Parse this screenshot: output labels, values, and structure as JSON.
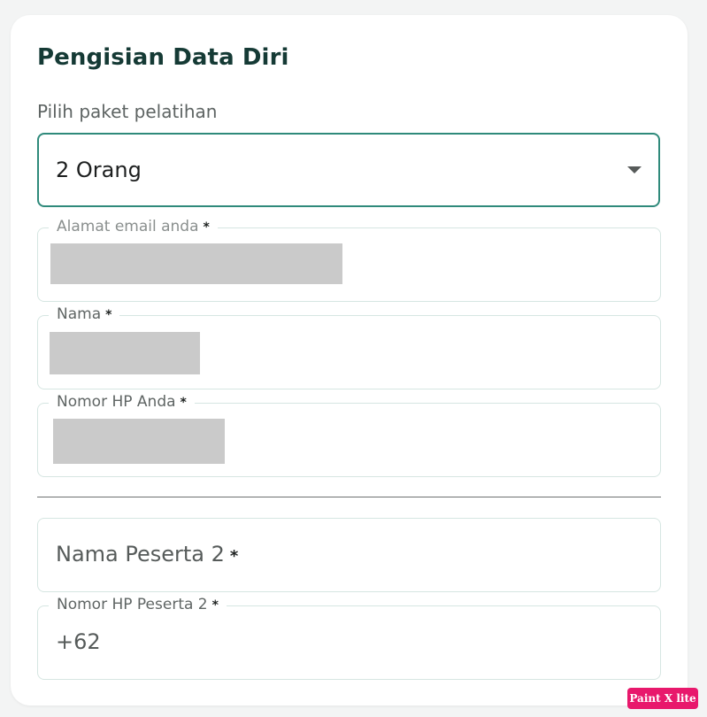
{
  "form": {
    "title": "Pengisian Data Diri",
    "package_select": {
      "label": "Pilih paket pelatihan",
      "value": "2 Orang"
    },
    "fields": {
      "email": {
        "label": "Alamat email anda",
        "required_mark": "*"
      },
      "name": {
        "label": "Nama",
        "required_mark": "*"
      },
      "phone": {
        "label": "Nomor HP Anda",
        "required_mark": "*"
      },
      "participant2_name": {
        "placeholder": "Nama Peserta 2",
        "required_mark": "*"
      },
      "participant2_phone": {
        "label": "Nomor HP Peserta 2",
        "required_mark": "*",
        "value": "+62"
      }
    }
  },
  "watermark": {
    "text": "Paint X lite"
  },
  "colors": {
    "title": "#153a35",
    "accent_border": "#2f8a7b",
    "field_border": "#d6e6e2",
    "redaction": "#cacaca",
    "badge": "#e8186c"
  }
}
